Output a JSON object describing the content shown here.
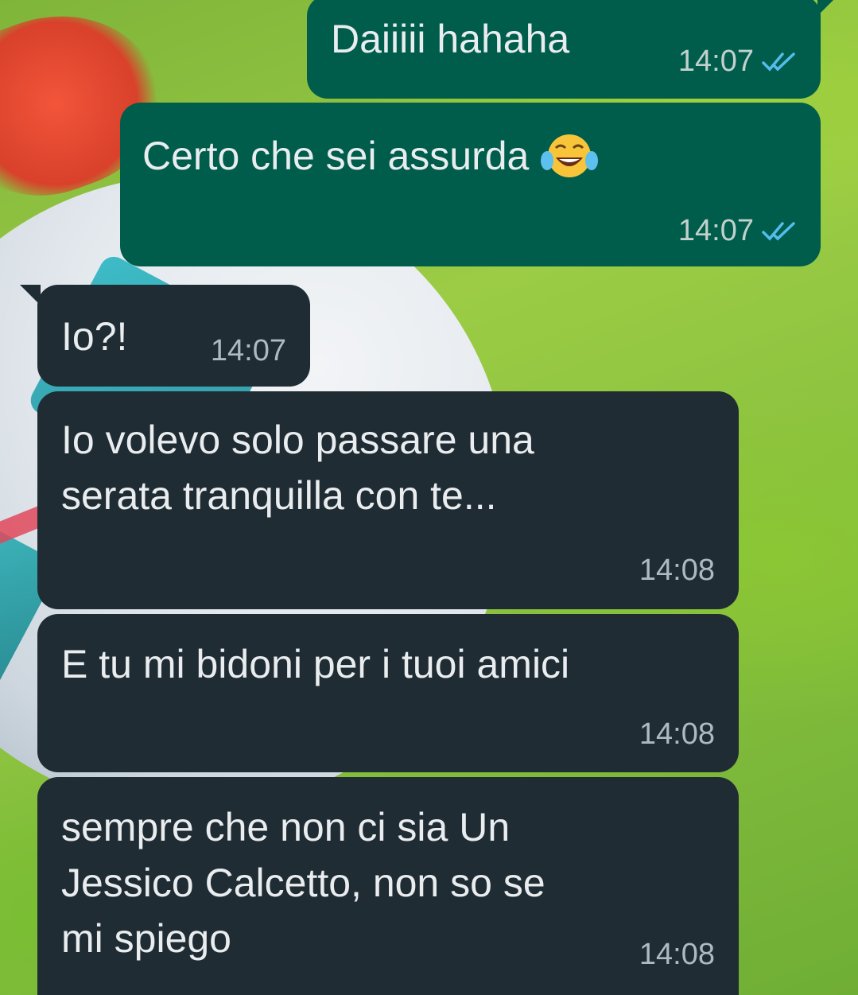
{
  "wallpaper": {
    "description_icon": "soccer-ball-on-grass-wallpaper"
  },
  "colors": {
    "outgoing_bubble": "#005c4b",
    "incoming_bubble": "#202c33",
    "read_receipt": "#53bdeb",
    "text": "#e9edef"
  },
  "messages": [
    {
      "direction": "outgoing",
      "lines": [
        "Daiiiii hahaha"
      ],
      "time": "14:07",
      "status_icon": "double-check-read-icon"
    },
    {
      "direction": "outgoing",
      "lines": [
        "Certo che sei assurda"
      ],
      "emoji": "face-with-tears-of-joy-icon",
      "time": "14:07",
      "status_icon": "double-check-read-icon"
    },
    {
      "direction": "incoming",
      "lines": [
        "Io?!"
      ],
      "time": "14:07"
    },
    {
      "direction": "incoming",
      "lines": [
        "Io volevo solo passare una",
        "serata tranquilla con te..."
      ],
      "time": "14:08"
    },
    {
      "direction": "incoming",
      "lines": [
        "E tu mi bidoni per i tuoi amici"
      ],
      "time": "14:08"
    },
    {
      "direction": "incoming",
      "lines": [
        "sempre che non ci sia Un",
        "Jessico Calcetto, non so se",
        "mi spiego"
      ],
      "time": "14:08"
    }
  ]
}
